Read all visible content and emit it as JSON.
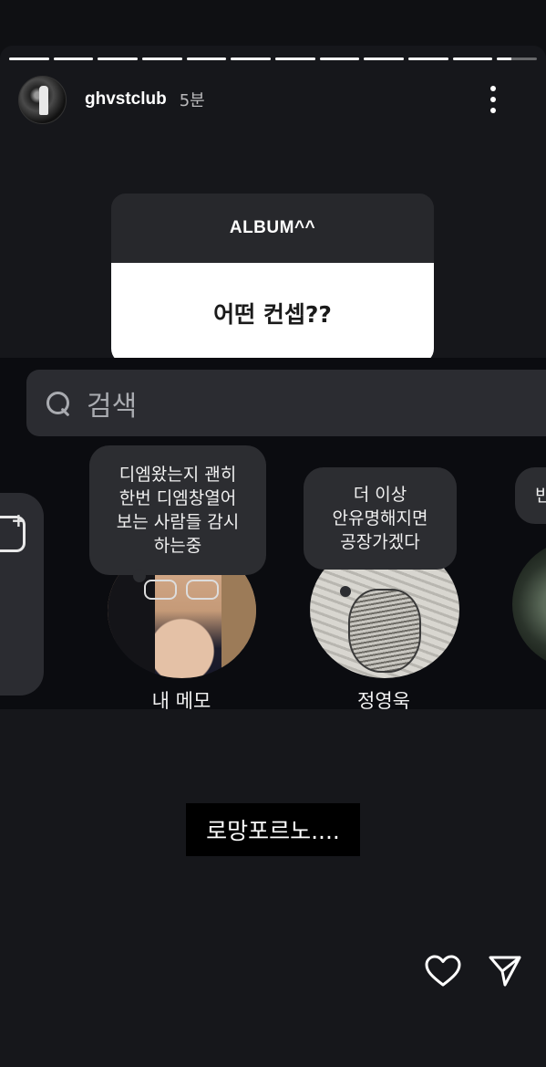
{
  "story": {
    "segments_total": 12,
    "segments_viewed": 11,
    "current_progress": 0.35,
    "user": {
      "username": "ghvstclub",
      "timestamp": "5분"
    }
  },
  "question_sticker": {
    "prompt": "ALBUM^^",
    "answer": "어떤 컨셉??"
  },
  "screenshot": {
    "search_placeholder": "검색",
    "notes": [
      {
        "text": "디엠왔는지 괜히\n한번 디엠창열어\n보는 사람들 감시\n하는중",
        "name": "내 메모"
      },
      {
        "text": "더 이상\n안유명해지면\n공장가겠다",
        "name": "정영욱"
      },
      {
        "text": "빈",
        "name": ""
      }
    ]
  },
  "caption": "로망포르노....",
  "colors": {
    "background": "#0f1013",
    "sticker_header": "#27282c",
    "bubble": "#2c2d31"
  },
  "icons": {
    "more": "more-vertical-icon",
    "like": "heart-icon",
    "share": "send-icon",
    "search": "search-icon"
  }
}
